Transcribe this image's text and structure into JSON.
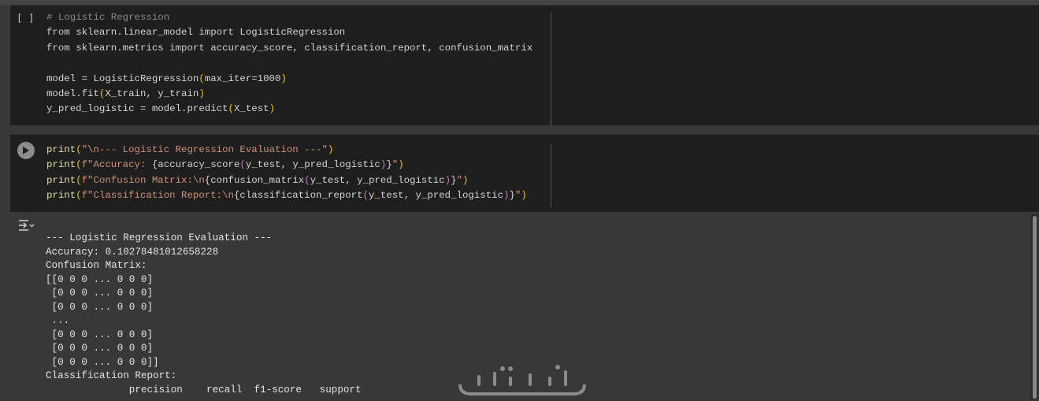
{
  "cell1": {
    "gutter_label": "[ ]",
    "lines": [
      "# Logistic Regression",
      "from sklearn.linear_model import LogisticRegression",
      "from sklearn.metrics import accuracy_score, classification_report, confusion_matrix",
      "",
      "model = LogisticRegression(max_iter=1000)",
      "model.fit(X_train, y_train)",
      "y_pred_logistic = model.predict(X_test)"
    ]
  },
  "cell2": {
    "lines": [
      "print(\"\\n--- Logistic Regression Evaluation ---\")",
      "print(f\"Accuracy: {accuracy_score(y_test, y_pred_logistic)}\")",
      "print(f\"Confusion Matrix:\\n{confusion_matrix(y_test, y_pred_logistic)}\")",
      "print(f\"Classification Report:\\n{classification_report(y_test, y_pred_logistic)}\")"
    ]
  },
  "output": {
    "lines": [
      "--- Logistic Regression Evaluation ---",
      "Accuracy: 0.10278481012658228",
      "Confusion Matrix:",
      "[[0 0 0 ... 0 0 0]",
      " [0 0 0 ... 0 0 0]",
      " [0 0 0 ... 0 0 0]",
      " ...",
      " [0 0 0 ... 0 0 0]",
      " [0 0 0 ... 0 0 0]",
      " [0 0 0 ... 0 0 0]]",
      "Classification Report:",
      "              precision    recall  f1-score   support"
    ]
  },
  "icons": {
    "run": "play-icon",
    "output": "output-toggle-icon",
    "watermark": "watermark-logo"
  },
  "colors": {
    "cell_bg": "#1e1e1e",
    "page_bg": "#383838",
    "keyword": "#c080e8",
    "string": "#ce9178",
    "bracket": "#f1c40f",
    "comment": "#8a8a8a"
  }
}
